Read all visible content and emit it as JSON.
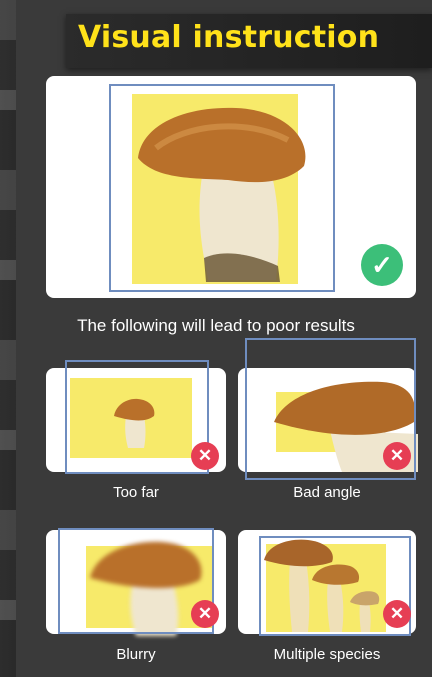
{
  "header": {
    "title": "Visual instruction"
  },
  "good_example": {
    "status_icon": "check-icon"
  },
  "warning": {
    "text": "The following will lead to poor results"
  },
  "bad_examples": [
    {
      "label": "Too far",
      "status_icon": "cross-icon"
    },
    {
      "label": "Bad angle",
      "status_icon": "cross-icon"
    },
    {
      "label": "Blurry",
      "status_icon": "cross-icon"
    },
    {
      "label": "Multiple species",
      "status_icon": "cross-icon"
    }
  ],
  "colors": {
    "title": "#ffe21a",
    "ok": "#3cbf79",
    "bad": "#e63e54",
    "frame": "#6f8dbf",
    "highlight": "#f7ea6a"
  }
}
